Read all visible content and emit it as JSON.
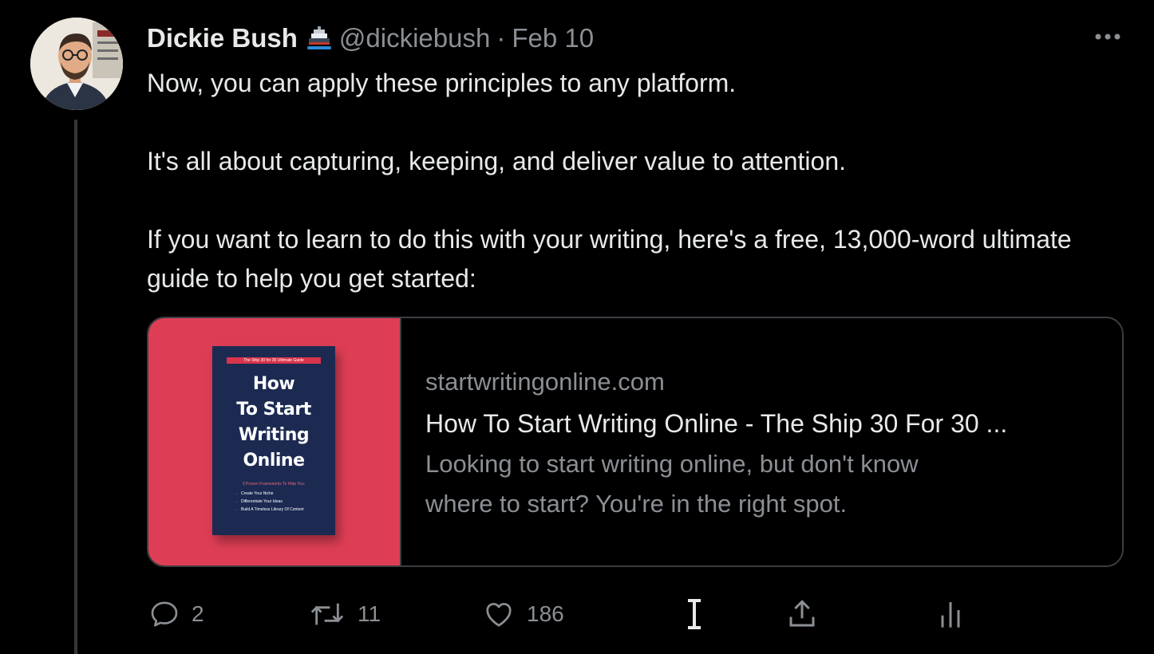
{
  "tweet": {
    "author_name": "Dickie Bush",
    "author_emoji": "ship-emoji",
    "handle": "@dickiebush",
    "separator": "·",
    "date": "Feb 10",
    "paragraphs": [
      "Now, you can apply these principles to any platform.",
      "It's all about capturing, keeping, and deliver value to attention.",
      "If you want to learn to do this with your writing, here's a free, 13,000-word ultimate guide to help you get started:"
    ]
  },
  "card": {
    "domain": "startwritingonline.com",
    "title": "How To Start Writing Online - The Ship 30 For 30 ...",
    "description_line1": "Looking to start writing online, but don't know",
    "description_line2": "where to start? You're in the right spot.",
    "image": {
      "banner": "The Ship 30 for 30 Ultimate Guide",
      "title_lines": [
        "How",
        "To Start",
        "Writing",
        "Online"
      ],
      "subtitle": "3 Proven Frameworks To Help You:",
      "bullets": [
        "Create Your Niche",
        "Differentiate Your Ideas",
        "Build A Timeless Library Of Content"
      ],
      "background": "#de3e55",
      "cover_color": "#1c2a52"
    }
  },
  "actions": {
    "reply_count": "2",
    "retweet_count": "11",
    "like_count": "186"
  },
  "colors": {
    "background": "#000000",
    "text_primary": "#e7e9ea",
    "text_secondary": "#8b8f94",
    "border": "#3a3d41"
  }
}
